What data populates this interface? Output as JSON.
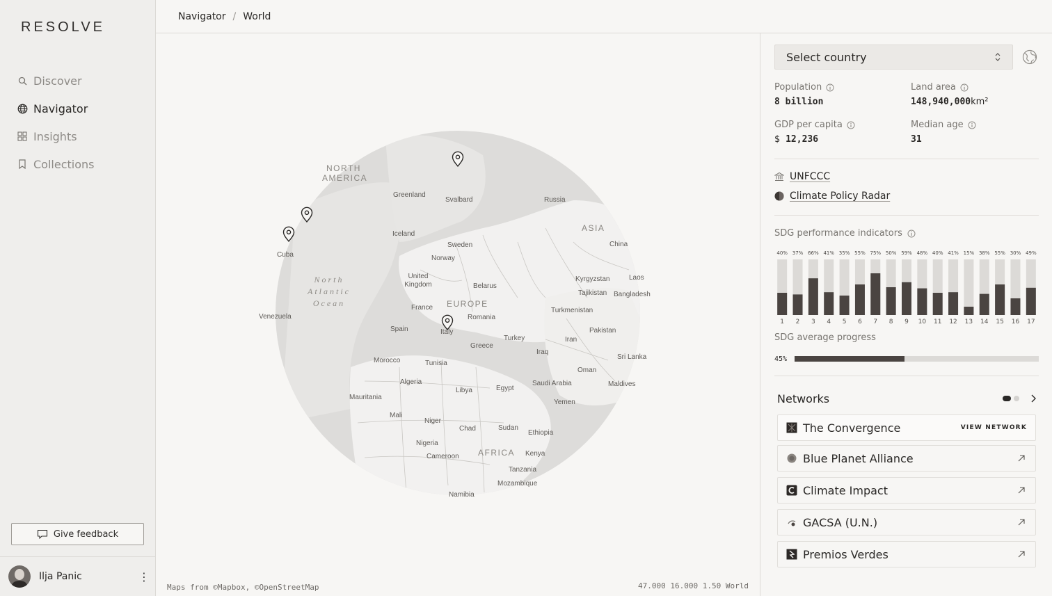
{
  "app": {
    "logo": "RESOLVE"
  },
  "sidebar": {
    "items": [
      {
        "label": "Discover",
        "icon": "search-icon",
        "active": false
      },
      {
        "label": "Navigator",
        "icon": "globe-icon",
        "active": true
      },
      {
        "label": "Insights",
        "icon": "grid-icon",
        "active": false
      },
      {
        "label": "Collections",
        "icon": "bookmark-icon",
        "active": false
      }
    ],
    "feedback_label": "Give feedback",
    "user": {
      "name": "Ilja Panic"
    }
  },
  "header": {
    "breadcrumb": [
      "Navigator",
      "World"
    ]
  },
  "map": {
    "attribution": "Maps from ©Mapbox, ©OpenStreetMap",
    "readout": "47.000 16.000 1.50 World",
    "labels": {
      "north_america": "NORTH AMERICA",
      "greenland": "Greenland",
      "svalbard": "Svalbard",
      "russia": "Russia",
      "asia": "ASIA",
      "china": "China",
      "iceland": "Iceland",
      "sweden": "Sweden",
      "norway": "Norway",
      "cuba": "Cuba",
      "north_atlantic_ocean": "North Atlantic Ocean",
      "united_kingdom": "United Kingdom",
      "belarus": "Belarus",
      "kyrgyzstan": "Kyrgyzstan",
      "laos": "Laos",
      "tajikistan": "Tajikistan",
      "bangladesh": "Bangladesh",
      "france": "France",
      "europe": "EUROPE",
      "turkmenistan": "Turkmenistan",
      "venezuela": "Venezuela",
      "romania": "Romania",
      "spain": "Spain",
      "italy": "Italy",
      "pakistan": "Pakistan",
      "turkey": "Turkey",
      "iran": "Iran",
      "greece": "Greece",
      "iraq": "Iraq",
      "sri_lanka": "Sri Lanka",
      "morocco": "Morocco",
      "tunisia": "Tunisia",
      "oman": "Oman",
      "algeria": "Algeria",
      "saudi_arabia": "Saudi Arabia",
      "maldives": "Maldives",
      "egypt": "Egypt",
      "libya": "Libya",
      "mauritania": "Mauritania",
      "yemen": "Yemen",
      "mali": "Mali",
      "niger": "Niger",
      "chad": "Chad",
      "sudan": "Sudan",
      "ethiopia": "Ethiopia",
      "nigeria": "Nigeria",
      "cameroon": "Cameroon",
      "africa": "AFRICA",
      "kenya": "Kenya",
      "tanzania": "Tanzania",
      "mozambique": "Mozambique",
      "namibia": "Namibia"
    }
  },
  "panel": {
    "select_placeholder": "Select country",
    "stats": {
      "population": {
        "label": "Population",
        "value": "8 billion"
      },
      "land_area": {
        "label": "Land area",
        "value": "148,940,000",
        "unit": "km²"
      },
      "gdp": {
        "label": "GDP per capita",
        "currency": "$",
        "value": "12,236"
      },
      "median_age": {
        "label": "Median age",
        "value": "31"
      }
    },
    "sources": [
      {
        "label": "UNFCCC",
        "icon": "institution-icon"
      },
      {
        "label": "Climate Policy Radar",
        "icon": "radar-logo-icon"
      }
    ],
    "sdg_title": "SDG performance indicators",
    "sdg_avg_label": "SDG average progress",
    "sdg_avg_value": "45%",
    "sdg_avg": 45,
    "networks": {
      "title": "Networks",
      "view_label": "VIEW NETWORK",
      "items": [
        {
          "name": "The Convergence"
        },
        {
          "name": "Blue Planet Alliance"
        },
        {
          "name": "Climate Impact"
        },
        {
          "name": "GACSA (U.N.)"
        },
        {
          "name": "Premios Verdes"
        }
      ]
    }
  },
  "chart_data": {
    "type": "bar",
    "title": "SDG performance indicators",
    "categories": [
      "1",
      "2",
      "3",
      "4",
      "5",
      "6",
      "7",
      "8",
      "9",
      "10",
      "11",
      "12",
      "13",
      "14",
      "15",
      "16",
      "17"
    ],
    "values": [
      40,
      37,
      66,
      41,
      35,
      55,
      75,
      50,
      59,
      48,
      40,
      41,
      15,
      38,
      55,
      30,
      49
    ],
    "value_labels": [
      "40%",
      "37%",
      "66%",
      "41%",
      "35%",
      "55%",
      "75%",
      "50%",
      "59%",
      "48%",
      "40%",
      "41%",
      "15%",
      "38%",
      "55%",
      "30%",
      "49%"
    ],
    "ylim": [
      0,
      100
    ],
    "colors": {
      "fill": "#4a4441",
      "track": "#dcdad7"
    }
  }
}
